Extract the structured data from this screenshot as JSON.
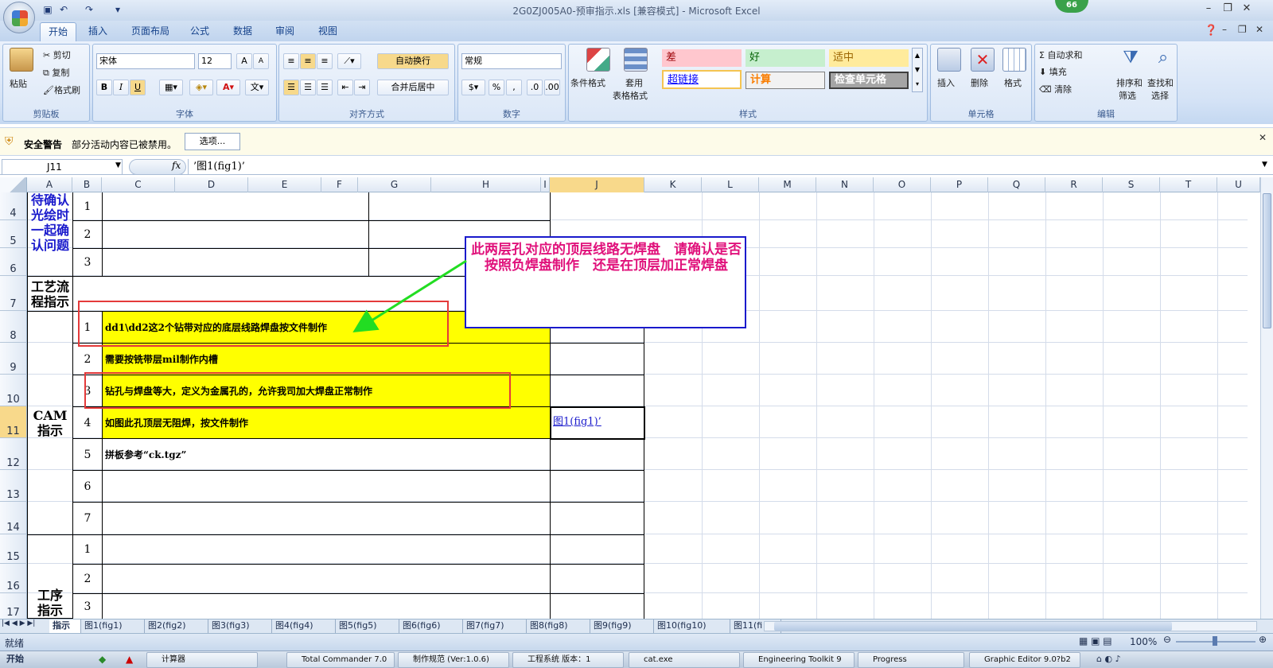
{
  "window": {
    "title": "2G0ZJ005A0-预审指示.xls  [兼容模式] - Microsoft Excel",
    "badge": "66"
  },
  "ribbon_tabs": [
    "开始",
    "插入",
    "页面布局",
    "公式",
    "数据",
    "审阅",
    "视图"
  ],
  "clipboard": {
    "paste": "粘贴",
    "cut": "剪切",
    "copy": "复制",
    "format_painter": "格式刷",
    "label": "剪贴板"
  },
  "font": {
    "name": "宋体",
    "size": "12",
    "label": "字体",
    "bold": "B",
    "italic": "I",
    "underline": "U"
  },
  "alignment": {
    "wrap": "自动换行",
    "merge": "合并后居中",
    "label": "对齐方式"
  },
  "number": {
    "format": "常规",
    "percent": "%",
    "comma": ",",
    "label": "数字"
  },
  "styles": {
    "conditional": "条件格式",
    "table_l1": "套用",
    "table_l2": "表格格式",
    "label": "样式",
    "bad": "差",
    "good": "好",
    "neutral": "适中",
    "hyperlink": "超链接",
    "calc": "计算",
    "check": "检查单元格"
  },
  "cells_group": {
    "insert": "插入",
    "delete": "删除",
    "format": "格式",
    "label": "单元格"
  },
  "editing": {
    "autosum": "自动求和",
    "fill": "填充",
    "clear": "清除",
    "sort_l1": "排序和",
    "sort_l2": "筛选",
    "find_l1": "查找和",
    "find_l2": "选择",
    "label": "编辑"
  },
  "security": {
    "title": "安全警告",
    "message": "部分活动内容已被禁用。",
    "options": "选项..."
  },
  "formula_bar": {
    "name_box": "J11",
    "fx": "fx",
    "content": "’图1(fig1)’"
  },
  "columns": [
    "A",
    "B",
    "C",
    "D",
    "E",
    "F",
    "G",
    "H",
    "I",
    "J",
    "K",
    "L",
    "M",
    "N",
    "O",
    "P",
    "Q",
    "R",
    "S",
    "T",
    "U"
  ],
  "rows": [
    "4",
    "5",
    "6",
    "7",
    "8",
    "9",
    "10",
    "11",
    "12",
    "13",
    "14",
    "15",
    "16",
    "17"
  ],
  "sheet": {
    "a_pending": "待确认光绘时一起确认问题",
    "a_process": "工艺流程指示",
    "a_cam": "CAM指示",
    "a_procedure": "工序指示",
    "b_pending": [
      "1",
      "2",
      "3"
    ],
    "b_cam": [
      "1",
      "2",
      "3",
      "4",
      "5",
      "6",
      "7"
    ],
    "b_proc": [
      "1",
      "2",
      "3"
    ],
    "cam_items": [
      "dd1\\dd2这2个钻带对应的底层线路焊盘按文件制作",
      "需要按铣带层mil制作内槽",
      "钻孔与焊盘等大，定义为金属孔的，允许我司加大焊盘正常制作",
      "如图此孔顶层无阻焊，按文件制作",
      "拼板参考“ck.tgz”"
    ],
    "j11": "图1(fig1)’"
  },
  "callout": "此两层孔对应的顶层线路无焊盘　请确认是否按照负焊盘制作　还是在顶层加正常焊盘",
  "sheet_tabs": [
    "指示",
    "图1(fig1)",
    "图2(fig2)",
    "图3(fig3)",
    "图4(fig4)",
    "图5(fig5)",
    "图6(fig6)",
    "图7(fig7)",
    "图8(fig8)",
    "图9(fig9)",
    "图10(fig10)",
    "图11(fi"
  ],
  "status": {
    "ready": "就绪",
    "zoom": "100%"
  },
  "taskbar": [
    "开始",
    "计算器",
    "Total Commander 7.0",
    "制作规范 (Ver:1.0.6)",
    "工程系统 版本：1",
    "cat.exe",
    "Engineering Toolkit 9",
    "Progress",
    "Graphic Editor 9.0?b2"
  ],
  "colors": {
    "highlight": "#ffff00",
    "callout_text": "#e0117b",
    "callout_border": "#1a1acc",
    "red_box": "#e43a3a",
    "arrow": "#22dd22",
    "label_blue": "#1a1acc"
  }
}
